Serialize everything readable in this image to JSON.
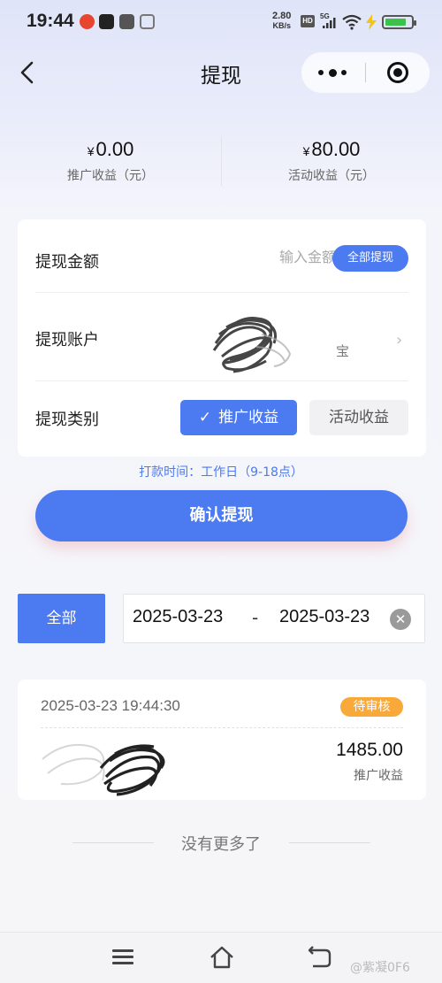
{
  "status_bar": {
    "time": "19:44",
    "net_speed_value": "2.80",
    "net_speed_unit": "KB/s",
    "hd_label": "HD",
    "network_label": "5G",
    "battery_level": 0.82,
    "icons": [
      "weibo-icon",
      "chat-app-icon",
      "flash-app-icon",
      "document-app-icon"
    ]
  },
  "nav": {
    "title": "提现",
    "back_icon": "chevron-left-icon",
    "more_icon": "more-dots-icon",
    "close_icon": "target-circle-icon"
  },
  "earnings": [
    {
      "currency": "¥",
      "amount": "0.00",
      "label": "推广收益（元）"
    },
    {
      "currency": "¥",
      "amount": "80.00",
      "label": "活动收益（元）"
    }
  ],
  "form": {
    "amount_label": "提现金额",
    "amount_placeholder": "输入金额",
    "withdraw_all_label": "全部提现",
    "account_label": "提现账户",
    "account_tail": "宝",
    "type_label": "提现类别",
    "type_options": [
      {
        "label": "推广收益",
        "selected": true
      },
      {
        "label": "活动收益",
        "selected": false
      }
    ]
  },
  "pay_time": "打款时间：工作日（9-18点）",
  "confirm_label": "确认提现",
  "filter": {
    "all_label": "全部",
    "date_start": "2025-03-23",
    "date_separator": "-",
    "date_end": "2025-03-23"
  },
  "records": [
    {
      "time": "2025-03-23 19:44:30",
      "status": "待审核",
      "amount": "1485.00",
      "type": "推广收益"
    }
  ],
  "no_more": "没有更多了",
  "watermark": "@紫凝0F6",
  "colors": {
    "accent": "#4b7af1",
    "pending": "#f8a93a"
  }
}
